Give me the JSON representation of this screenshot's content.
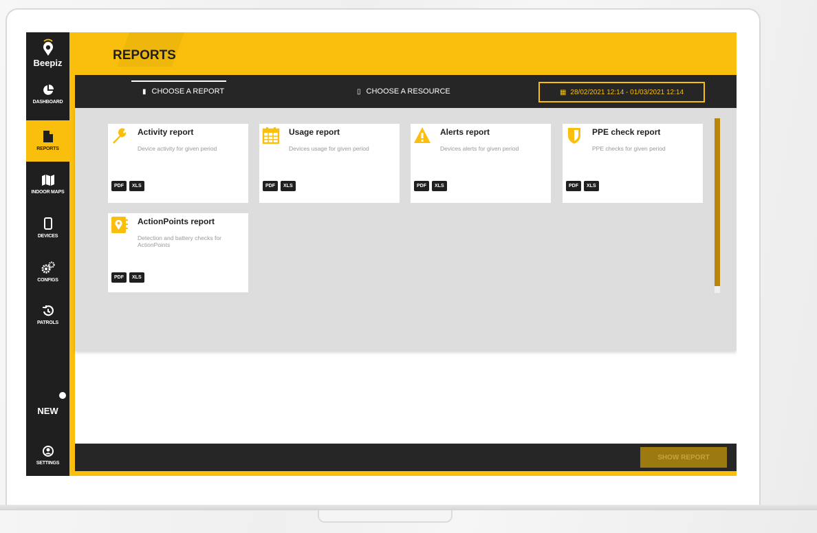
{
  "brand": {
    "name": "Beepiz"
  },
  "sidebar": {
    "items": [
      {
        "label": "DASHBOARD",
        "icon": "pie-chart-icon"
      },
      {
        "label": "REPORTS",
        "icon": "document-icon",
        "active": true
      },
      {
        "label": "INDOOR MAPS",
        "icon": "map-icon"
      },
      {
        "label": "DEVICES",
        "icon": "phone-icon"
      },
      {
        "label": "CONFIGS",
        "icon": "gears-icon"
      },
      {
        "label": "PATROLS",
        "icon": "history-icon"
      }
    ],
    "new_label": "NEW",
    "settings_label": "SETTINGS"
  },
  "header": {
    "title": "REPORTS"
  },
  "tabs": {
    "choose_report": "CHOOSE A REPORT",
    "choose_resource": "CHOOSE A RESOURCE",
    "date_range": "28/02/2021 12:14 - 01/03/2021 12:14"
  },
  "reports": [
    {
      "title": "Activity report",
      "desc": "Device activity for given period",
      "icon": "wrench-icon"
    },
    {
      "title": "Usage report",
      "desc": "Devices usage for given period",
      "icon": "calendar-icon"
    },
    {
      "title": "Alerts report",
      "desc": "Devices alerts for given period",
      "icon": "warning-icon"
    },
    {
      "title": "PPE check report",
      "desc": "PPE checks for given period",
      "icon": "shield-icon"
    },
    {
      "title": "ActionPoints report",
      "desc": "Detection and battery checks for ActionPoints",
      "icon": "location-pin-icon"
    }
  ],
  "badges": {
    "pdf": "PDF",
    "xls": "XLS"
  },
  "footer": {
    "show_report": "SHOW REPORT"
  },
  "colors": {
    "accent": "#f9bf0c",
    "dark": "#1f1f1f",
    "button": "#9d7a10"
  }
}
